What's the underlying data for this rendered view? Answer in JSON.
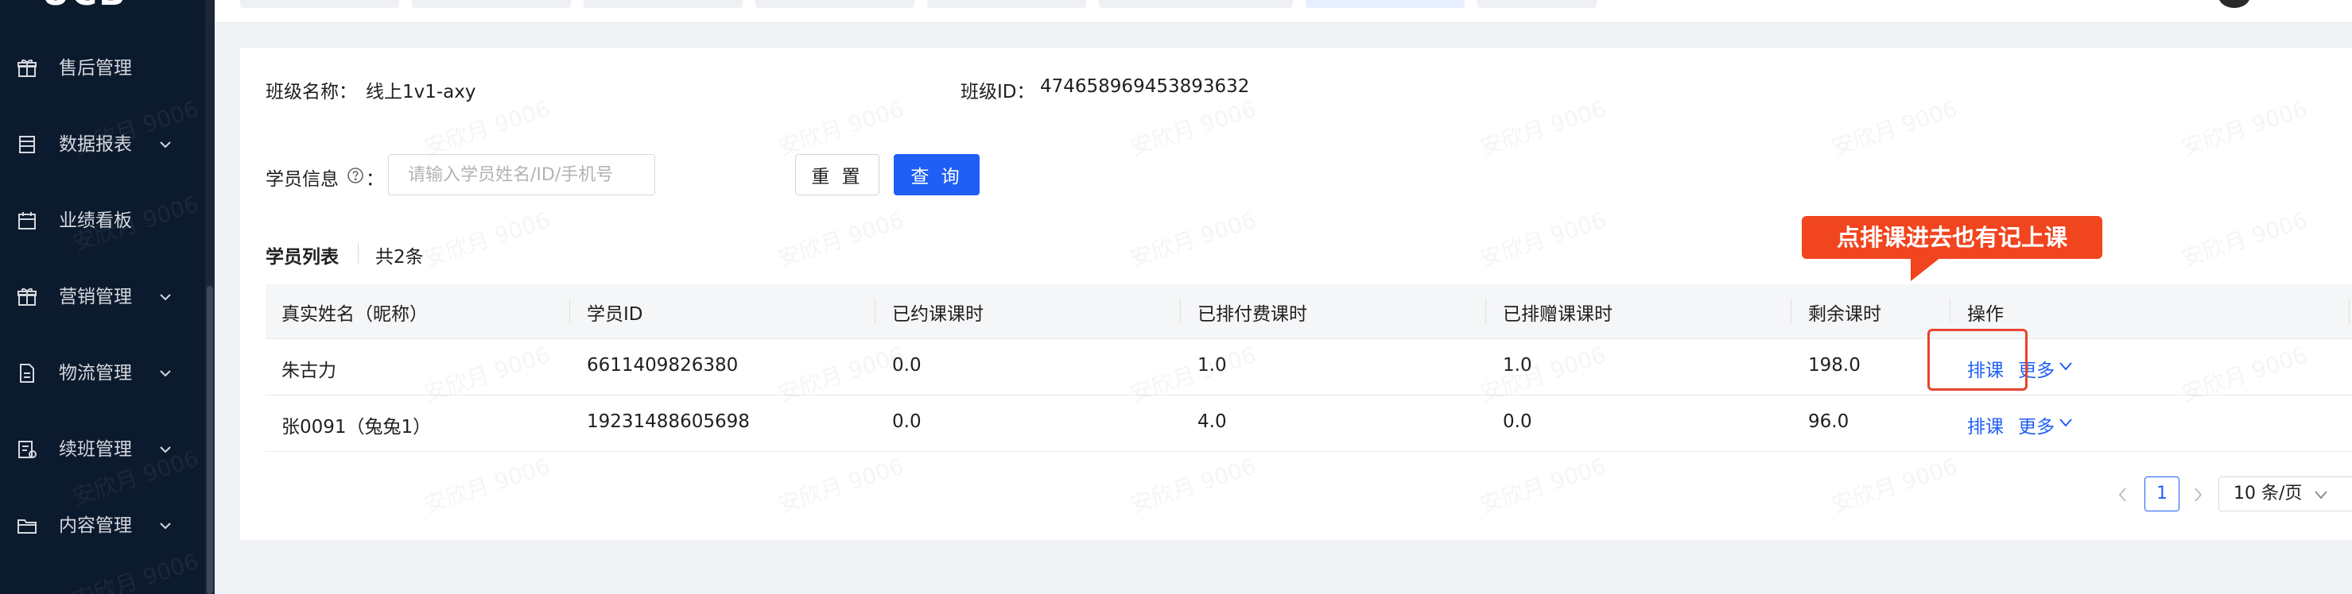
{
  "sidebar": {
    "logo_text": "UCB",
    "items": [
      {
        "label": "售后管理",
        "icon": "gift-icon",
        "has_submenu": false
      },
      {
        "label": "数据报表",
        "icon": "report-icon",
        "has_submenu": true
      },
      {
        "label": "业绩看板",
        "icon": "calendar-icon",
        "has_submenu": false
      },
      {
        "label": "营销管理",
        "icon": "gift-icon",
        "has_submenu": true
      },
      {
        "label": "物流管理",
        "icon": "document-icon",
        "has_submenu": true
      },
      {
        "label": "续班管理",
        "icon": "register-icon",
        "has_submenu": true
      },
      {
        "label": "内容管理",
        "icon": "folder-icon",
        "has_submenu": true
      }
    ]
  },
  "class_info": {
    "name_label": "班级名称：",
    "name_value": "线上1v1-axy",
    "id_label": "班级ID：",
    "id_value": "474658969453893632"
  },
  "search": {
    "label": "学员信息",
    "label_suffix": "：",
    "placeholder": "请输入学员姓名/ID/手机号",
    "value": "",
    "reset_label": "重 置",
    "query_label": "查 询"
  },
  "list": {
    "title": "学员列表",
    "count": "共2条"
  },
  "table": {
    "columns": [
      "真实姓名（昵称）",
      "学员ID",
      "已约课课时",
      "已排付费课时",
      "已排赠课课时",
      "剩余课时",
      "操作"
    ],
    "rows": [
      {
        "name": "朱古力",
        "student_id": "6611409826380",
        "booked": "0.0",
        "paid": "1.0",
        "gift": "1.0",
        "remaining": "198.0",
        "action_schedule": "排课",
        "action_more": "更多"
      },
      {
        "name": "张0091（兔兔1）",
        "student_id": "19231488605698",
        "booked": "0.0",
        "paid": "4.0",
        "gift": "0.0",
        "remaining": "96.0",
        "action_schedule": "排课",
        "action_more": "更多"
      }
    ]
  },
  "pagination": {
    "current_page": "1",
    "page_size": "10 条/页"
  },
  "annotation": {
    "callout_text": "点排课进去也有记上课"
  },
  "watermark": {
    "text": "安欣月 9006"
  },
  "colors": {
    "sidebar_bg": "#0c1a2e",
    "primary": "#1f5ff5",
    "annotation": "#f0451e"
  }
}
